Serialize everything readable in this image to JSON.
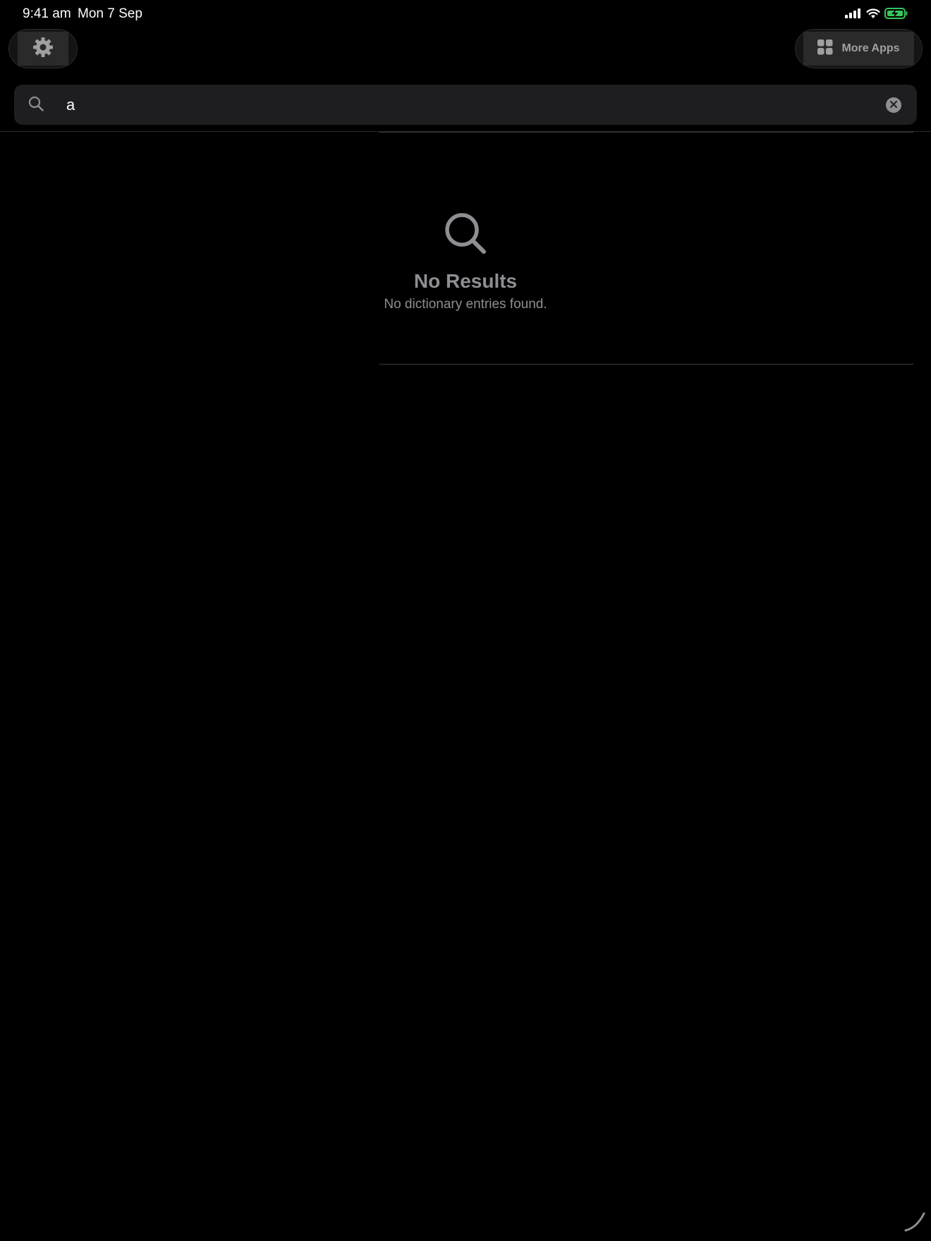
{
  "status_bar": {
    "time": "9:41 am",
    "date": "Mon 7 Sep",
    "icons": [
      "signal-icon",
      "wifi-icon",
      "battery-charging-icon"
    ],
    "battery_color": "#34c759"
  },
  "toolbar": {
    "settings_icon": "gear-icon",
    "more_apps_icon": "grid-icon",
    "more_apps_label": "More Apps"
  },
  "search": {
    "value": "a",
    "placeholder": "Search",
    "icon": "search-icon",
    "clear_icon": "clear-icon"
  },
  "empty_state": {
    "icon": "search-icon",
    "title": "No Results",
    "subtitle": "No dictionary entries found."
  },
  "colors": {
    "background": "#000000",
    "search_field": "#1e1e20",
    "secondary_text": "#8e8e93"
  }
}
